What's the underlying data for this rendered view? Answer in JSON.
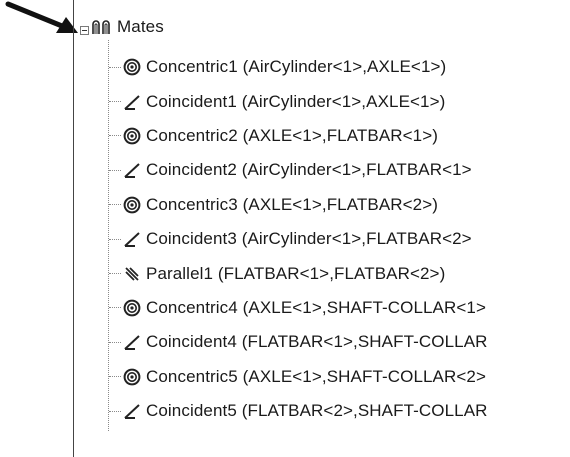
{
  "tree": {
    "folder_label": "Mates",
    "folder_icon": "mates-folder-icon",
    "expander_state": "expanded",
    "items": [
      {
        "label": "Concentric1 (AirCylinder<1>,AXLE<1>)",
        "icon": "concentric-mate-icon"
      },
      {
        "label": "Coincident1 (AirCylinder<1>,AXLE<1>)",
        "icon": "coincident-mate-icon"
      },
      {
        "label": "Concentric2 (AXLE<1>,FLATBAR<1>)",
        "icon": "concentric-mate-icon"
      },
      {
        "label": "Coincident2 (AirCylinder<1>,FLATBAR<1>",
        "icon": "coincident-mate-icon"
      },
      {
        "label": "Concentric3 (AXLE<1>,FLATBAR<2>)",
        "icon": "concentric-mate-icon"
      },
      {
        "label": "Coincident3 (AirCylinder<1>,FLATBAR<2>",
        "icon": "coincident-mate-icon"
      },
      {
        "label": "Parallel1 (FLATBAR<1>,FLATBAR<2>)",
        "icon": "parallel-mate-icon"
      },
      {
        "label": "Concentric4 (AXLE<1>,SHAFT-COLLAR<1>",
        "icon": "concentric-mate-icon"
      },
      {
        "label": "Coincident4 (FLATBAR<1>,SHAFT-COLLAR",
        "icon": "coincident-mate-icon"
      },
      {
        "label": "Concentric5 (AXLE<1>,SHAFT-COLLAR<2>",
        "icon": "concentric-mate-icon"
      },
      {
        "label": "Coincident5 (FLATBAR<2>,SHAFT-COLLAR",
        "icon": "coincident-mate-icon"
      }
    ]
  },
  "colors": {
    "text": "#1a1a1a",
    "tree_lines": "#8a8a8a",
    "panel_border": "#444444",
    "icon": "#222222"
  }
}
